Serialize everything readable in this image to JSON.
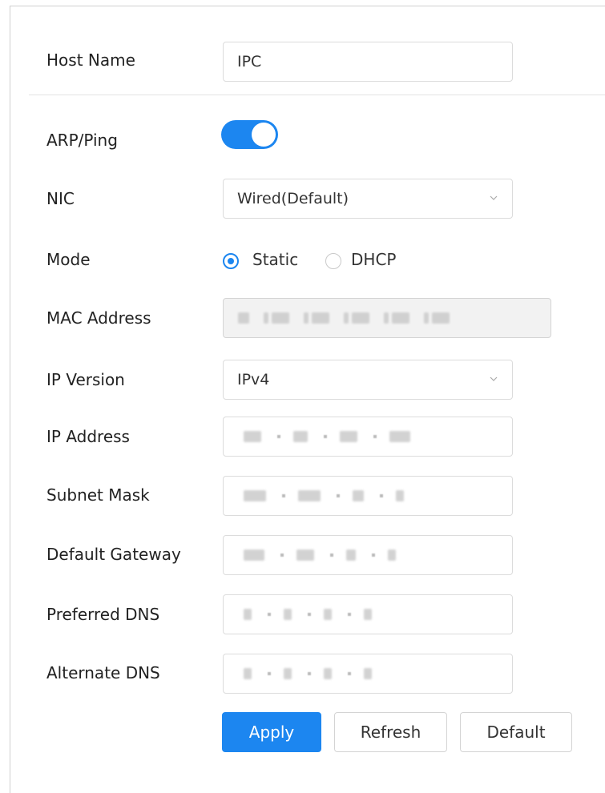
{
  "form": {
    "host_name": {
      "label": "Host Name",
      "value": "IPC"
    },
    "arp_ping": {
      "label": "ARP/Ping",
      "enabled": true
    },
    "nic": {
      "label": "NIC",
      "value": "Wired(Default)"
    },
    "mode": {
      "label": "Mode",
      "options": [
        "Static",
        "DHCP"
      ],
      "selected": "Static"
    },
    "mac_address": {
      "label": "MAC Address"
    },
    "ip_version": {
      "label": "IP Version",
      "value": "IPv4"
    },
    "ip_address": {
      "label": "IP Address"
    },
    "subnet_mask": {
      "label": "Subnet Mask"
    },
    "default_gateway": {
      "label": "Default Gateway"
    },
    "preferred_dns": {
      "label": "Preferred DNS"
    },
    "alternate_dns": {
      "label": "Alternate DNS"
    }
  },
  "buttons": {
    "apply": "Apply",
    "refresh": "Refresh",
    "default": "Default"
  },
  "colors": {
    "accent": "#1c86f0",
    "field_border": "#dcdcdc",
    "disabled_bg": "#f2f2f2"
  },
  "icons": {
    "dropdown": "chevron-down-icon",
    "toggle": "toggle-switch"
  }
}
